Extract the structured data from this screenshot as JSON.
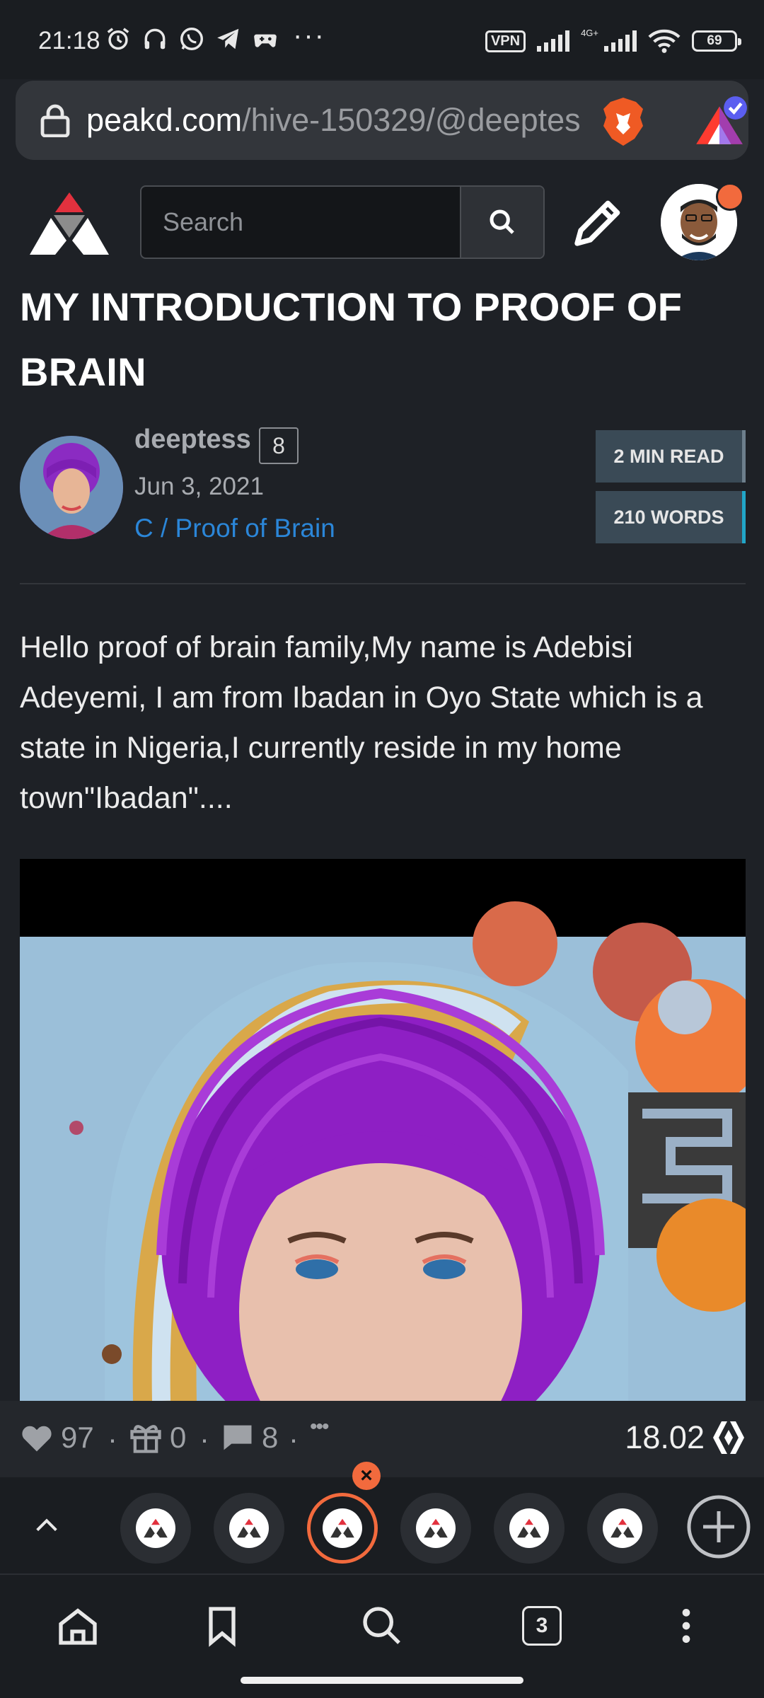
{
  "status_bar": {
    "time": "21:18",
    "more": "···",
    "vpn": "VPN",
    "network": "4G+",
    "battery": "69"
  },
  "browser": {
    "url_domain": "peakd.com",
    "url_path": "/hive-150329/@deeptes"
  },
  "app_header": {
    "search_placeholder": "Search"
  },
  "post": {
    "title": "MY INTRODUCTION TO PROOF OF BRAIN",
    "author": "deeptess",
    "reputation": "8",
    "date": "Jun 3, 2021",
    "community": "C / Proof of Brain",
    "read_time": "2 MIN READ",
    "word_count": "210 WORDS",
    "body": "Hello proof of brain family,My name is Adebisi Adeyemi, I am from Ibadan in Oyo State which is a state in Nigeria,I currently reside in my home town\"Ibadan\"...."
  },
  "actions": {
    "votes": "97",
    "gifts": "0",
    "comments": "8",
    "separator": "·",
    "more": "•••",
    "payout": "18.02"
  },
  "tab_strip": {
    "tabs_count": 6,
    "active_tab": 3,
    "close_label": "×"
  },
  "bottom_nav": {
    "tabs_count": "3"
  },
  "colors": {
    "background": "#1e2126",
    "accent": "#f26a3d",
    "link": "#2b86d8",
    "badge": "#3a4a56"
  }
}
